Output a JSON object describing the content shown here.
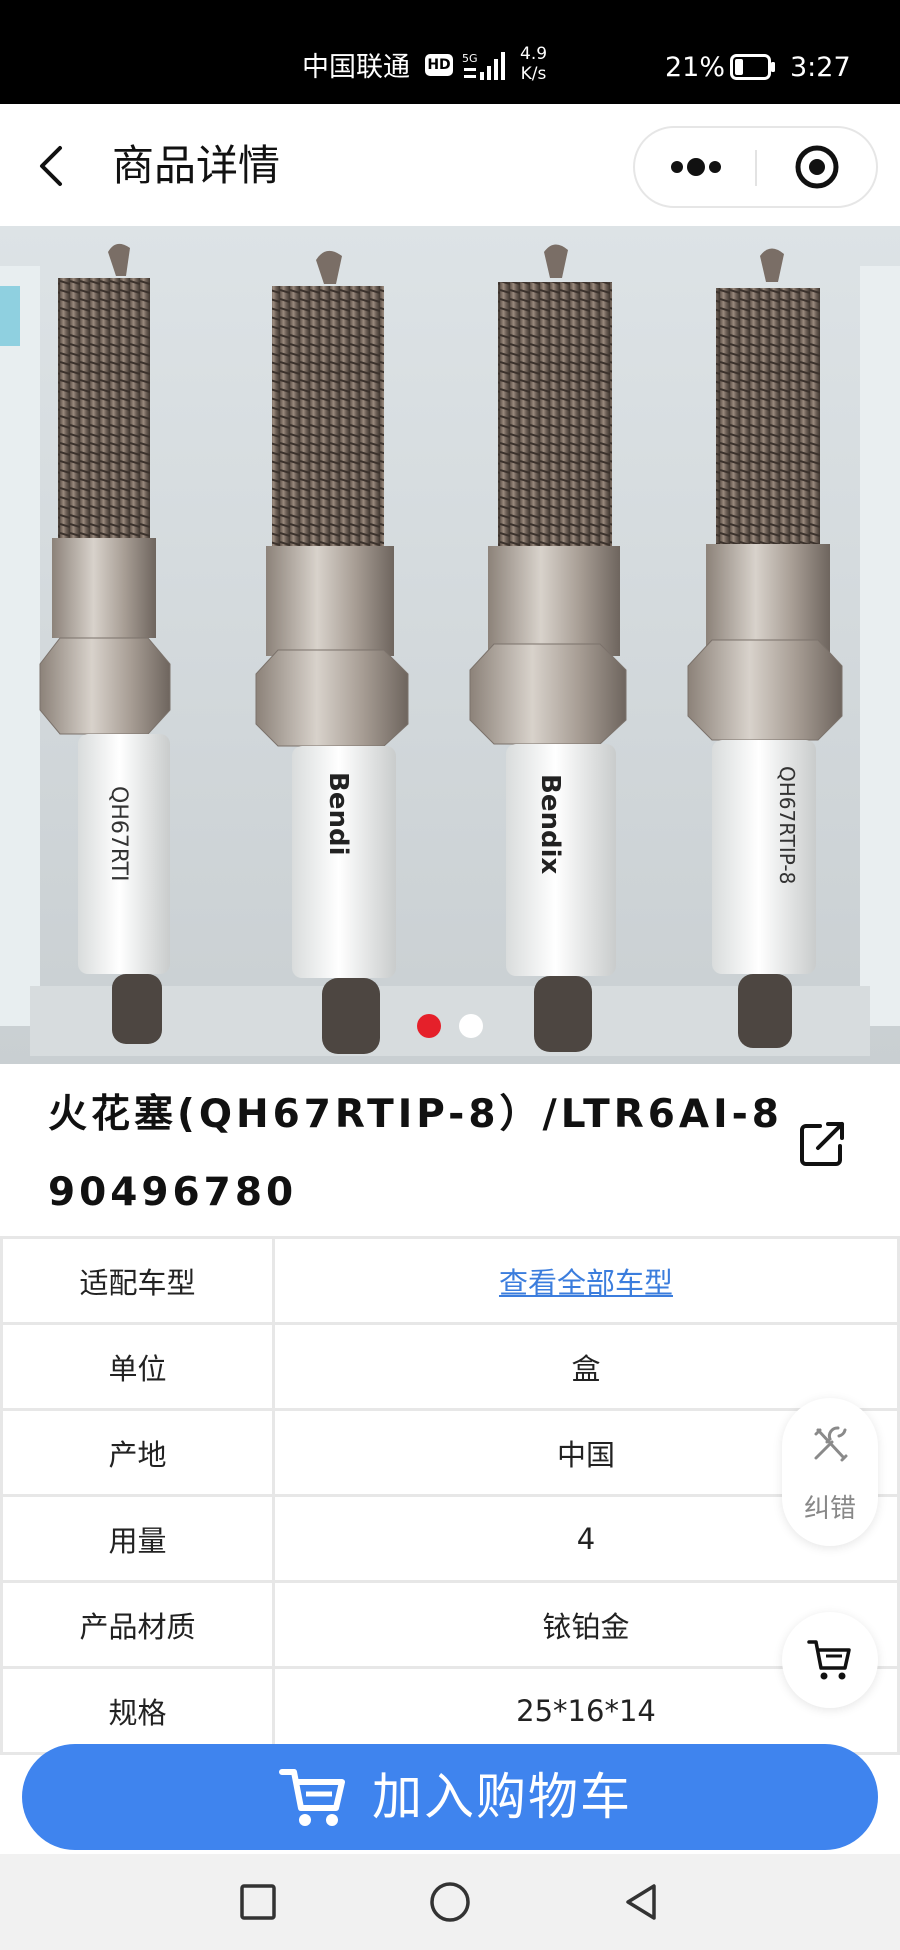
{
  "status_bar": {
    "carrier": "中国联通",
    "hd": "HD",
    "network": "5G",
    "speed_value": "4.9",
    "speed_unit": "K/s",
    "battery_percent": "21%",
    "time": "3:27"
  },
  "nav": {
    "title": "商品详情",
    "icons": {
      "back": "chevron-left-icon",
      "more": "more-dots-icon",
      "target": "target-icon"
    }
  },
  "gallery": {
    "image_text": [
      "QH67RTI",
      "Bendi",
      "Bendix",
      "QH67RTIP-8"
    ],
    "page_count": 2,
    "active_index": 0,
    "dot_active_color": "#e5202a"
  },
  "product": {
    "title": "火花塞(QH67RTIP-8）/LTR6AI-8 90496780"
  },
  "specs": [
    {
      "label": "适配车型",
      "value": "查看全部车型",
      "is_link": true
    },
    {
      "label": "单位",
      "value": "盒"
    },
    {
      "label": "产地",
      "value": "中国"
    },
    {
      "label": "用量",
      "value": "4"
    },
    {
      "label": "产品材质",
      "value": "铱铂金"
    },
    {
      "label": "规格",
      "value": "25*16*14"
    }
  ],
  "floating": {
    "correct_label": "纠错",
    "correct_icon": "wrench-screwdriver-icon",
    "cart_icon": "cart-icon"
  },
  "cta": {
    "label": "加入购物车",
    "color": "#3f84ee"
  },
  "colors": {
    "accent": "#3f84ee",
    "link": "#3b7ddd"
  }
}
